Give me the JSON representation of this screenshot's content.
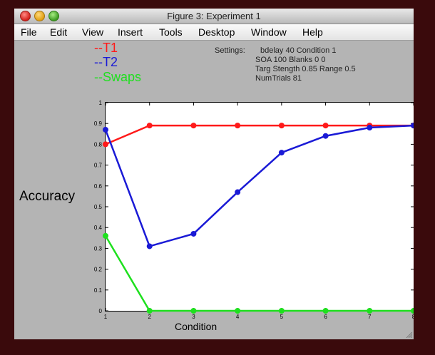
{
  "window": {
    "title": "Figure 3: Experiment 1"
  },
  "menu": {
    "items": [
      "File",
      "Edit",
      "View",
      "Insert",
      "Tools",
      "Desktop",
      "Window",
      "Help"
    ]
  },
  "legend": {
    "t1": "--T1",
    "t2": "--T2",
    "swaps": "--Swaps"
  },
  "settings": {
    "label": "Settings:",
    "line1": "bdelay 40   Condition 1",
    "line2": "SOA 100     Blanks 0 0",
    "line3": "Targ Stength 0.85   Range 0.5",
    "line4": "NumTrials 81"
  },
  "colors": {
    "t1": "#ff1a1a",
    "t2": "#1a1ad6",
    "swaps": "#1ee01e",
    "background": "#b4b4b4"
  },
  "chart_data": {
    "type": "line",
    "xlabel": "Condition",
    "ylabel": "Accuracy",
    "x": [
      1,
      2,
      3,
      4,
      5,
      6,
      7,
      8
    ],
    "xlim": [
      1,
      8
    ],
    "ylim": [
      0,
      1
    ],
    "xticks": [
      "1",
      "2",
      "3",
      "4",
      "5",
      "6",
      "7",
      "8"
    ],
    "yticks": [
      "0",
      "0.1",
      "0.2",
      "0.3",
      "0.4",
      "0.5",
      "0.6",
      "0.7",
      "0.8",
      "0.9",
      "1"
    ],
    "series": [
      {
        "name": "T1",
        "color": "#ff1a1a",
        "values": [
          0.8,
          0.89,
          0.89,
          0.89,
          0.89,
          0.89,
          0.89,
          0.89
        ]
      },
      {
        "name": "T2",
        "color": "#1a1ad6",
        "values": [
          0.87,
          0.31,
          0.37,
          0.57,
          0.76,
          0.84,
          0.88,
          0.89
        ]
      },
      {
        "name": "Swaps",
        "color": "#1ee01e",
        "values": [
          0.36,
          0,
          0,
          0,
          0,
          0,
          0,
          0
        ]
      }
    ]
  }
}
